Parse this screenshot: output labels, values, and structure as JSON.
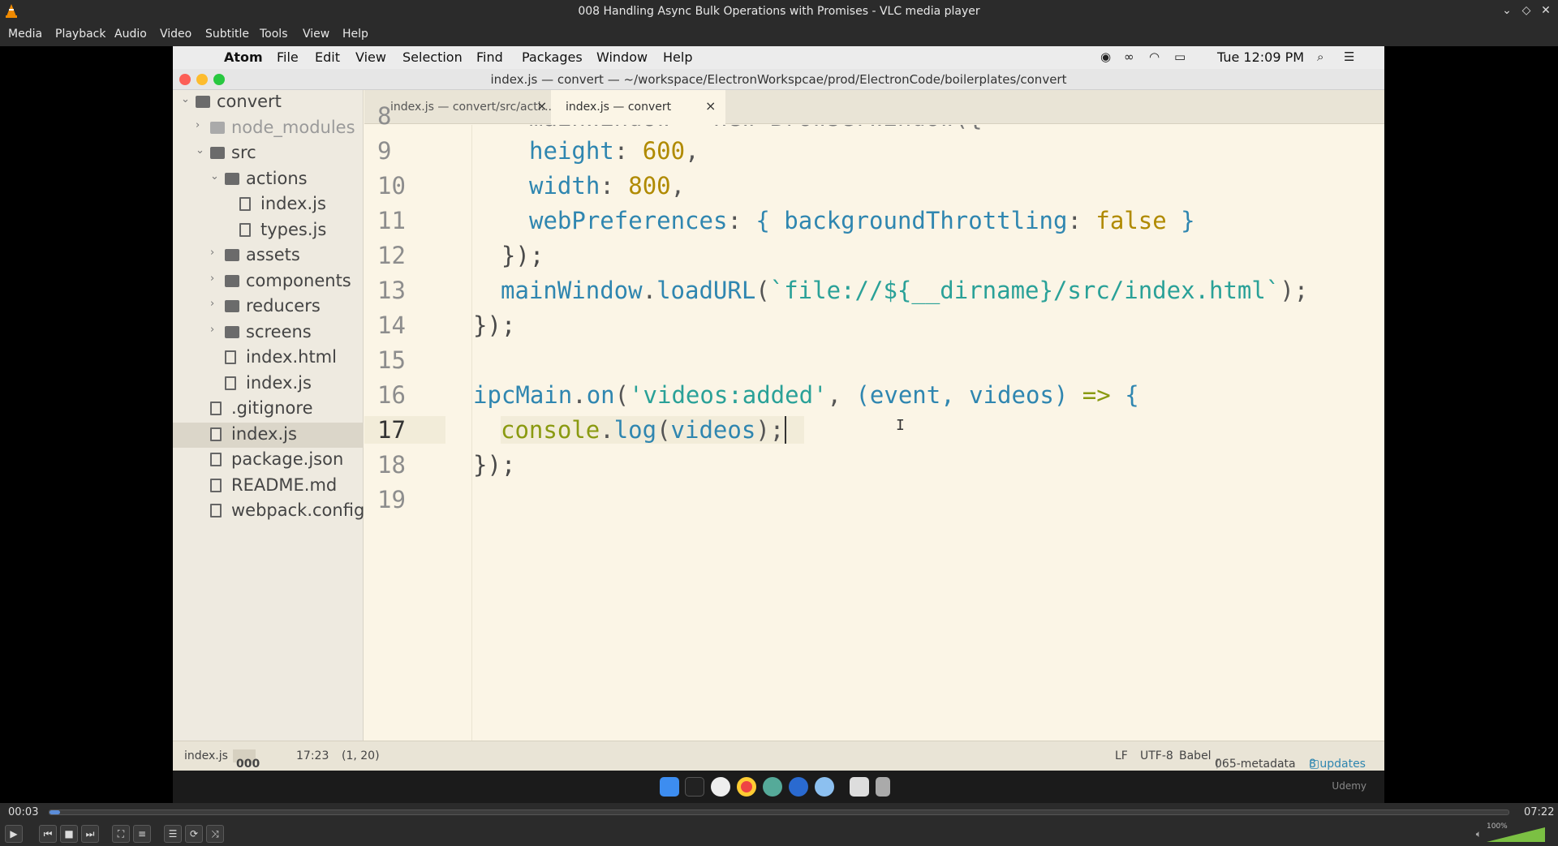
{
  "vlc": {
    "title": "008 Handling Async Bulk Operations with Promises - VLC media player",
    "menu": [
      "Media",
      "Playback",
      "Audio",
      "Video",
      "Subtitle",
      "Tools",
      "View",
      "Help"
    ],
    "elapsed": "00:03",
    "total": "07:22",
    "progress_fraction": 0.007,
    "volume_label": "100%",
    "volume_fraction": 1.0
  },
  "mac": {
    "menu": [
      "Atom",
      "File",
      "Edit",
      "View",
      "Selection",
      "Find",
      "Packages",
      "Window",
      "Help"
    ],
    "clock": "Tue 12:09 PM"
  },
  "atom": {
    "window_title": "index.js — convert — ~/workspace/ElectronWorkspcae/prod/ElectronCode/boilerplates/convert",
    "tree": [
      {
        "label": "convert",
        "type": "folder",
        "depth": 0,
        "expanded": true
      },
      {
        "label": "node_modules",
        "type": "folder",
        "depth": 1,
        "expanded": false,
        "dim": true
      },
      {
        "label": "src",
        "type": "folder",
        "depth": 1,
        "expanded": true
      },
      {
        "label": "actions",
        "type": "folder",
        "depth": 2,
        "expanded": true
      },
      {
        "label": "index.js",
        "type": "file",
        "depth": 3
      },
      {
        "label": "types.js",
        "type": "file",
        "depth": 3
      },
      {
        "label": "assets",
        "type": "folder",
        "depth": 2,
        "expanded": false
      },
      {
        "label": "components",
        "type": "folder",
        "depth": 2,
        "expanded": false
      },
      {
        "label": "reducers",
        "type": "folder",
        "depth": 2,
        "expanded": false
      },
      {
        "label": "screens",
        "type": "folder",
        "depth": 2,
        "expanded": false
      },
      {
        "label": "index.html",
        "type": "file",
        "depth": 2
      },
      {
        "label": "index.js",
        "type": "file",
        "depth": 2
      },
      {
        "label": ".gitignore",
        "type": "file",
        "depth": 1
      },
      {
        "label": "index.js",
        "type": "file",
        "depth": 1,
        "selected": true
      },
      {
        "label": "package.json",
        "type": "file",
        "depth": 1
      },
      {
        "label": "README.md",
        "type": "file",
        "depth": 1
      },
      {
        "label": "webpack.config.",
        "type": "file",
        "depth": 1
      }
    ],
    "tabs": [
      {
        "label": "index.js — convert/src/acti...",
        "active": false
      },
      {
        "label": "index.js — convert",
        "active": true
      }
    ],
    "line_numbers": [
      "8",
      "9",
      "10",
      "11",
      "12",
      "13",
      "14",
      "15",
      "16",
      "17",
      "18",
      "19"
    ],
    "current_line": "17",
    "code": {
      "l8": "  mainWindow = new BrowserWindow({",
      "l9_key": "height",
      "l9_val": "600",
      "l10_key": "width",
      "l10_val": "800",
      "l11_key": "webPreferences",
      "l11_inner_key": "backgroundThrottling",
      "l11_inner_val": "false",
      "l12": "  });",
      "l13_obj": "mainWindow",
      "l13_fn": "loadURL",
      "l13_str": "`file://${__dirname}/src/index.html`",
      "l14": "});",
      "l16_obj": "ipcMain",
      "l16_fn": "on",
      "l16_str": "'videos:added'",
      "l16_args": "(event, videos)",
      "l17_obj": "console",
      "l17_fn": "log",
      "l17_arg": "videos",
      "l18": "});"
    },
    "status": {
      "file": "index.js",
      "counts": [
        "0",
        "0",
        "0"
      ],
      "position": "17:23",
      "selection": "(1, 20)",
      "line_ending": "LF",
      "encoding": "UTF-8",
      "grammar": "Babel",
      "branch": "065-metadata",
      "updates": "8 updates"
    }
  },
  "watermark": "Udemy",
  "colors": {
    "accent_blue": "#2f86b0",
    "editor_bg": "#fbf5e6",
    "progress_blue": "#5b8dd9",
    "volume_green": "#7bc043"
  }
}
